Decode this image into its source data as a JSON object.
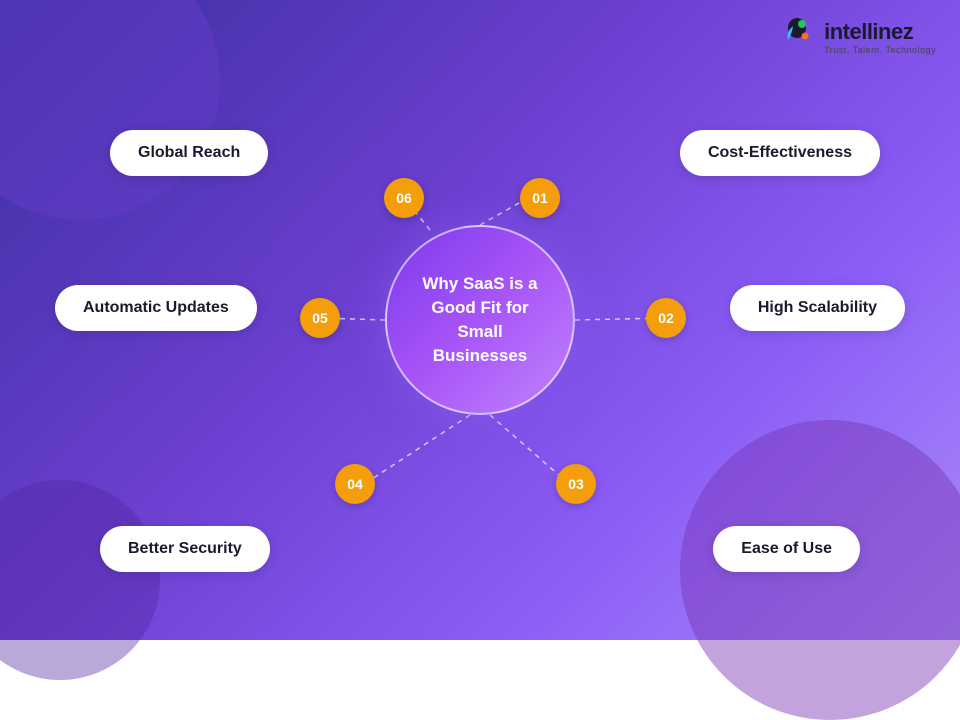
{
  "logo": {
    "name": "intellinez",
    "tagline": "Trust. Talent. Technology"
  },
  "center": {
    "text": "Why SaaS is a\nGood Fit for\nSmall\nBusinesses"
  },
  "items": [
    {
      "id": "01",
      "label": "Cost-Effectiveness"
    },
    {
      "id": "02",
      "label": "High Scalability"
    },
    {
      "id": "03",
      "label": "Ease of Use"
    },
    {
      "id": "04",
      "label": "Better Security"
    },
    {
      "id": "05",
      "label": "Automatic Updates"
    },
    {
      "id": "06",
      "label": "Global Reach"
    }
  ],
  "colors": {
    "bg_start": "#3b2fa0",
    "bg_end": "#a78bfa",
    "badge": "#f59e0b",
    "pill_bg": "#ffffff",
    "center_text": "#ffffff",
    "line": "rgba(255,255,255,0.7)"
  }
}
